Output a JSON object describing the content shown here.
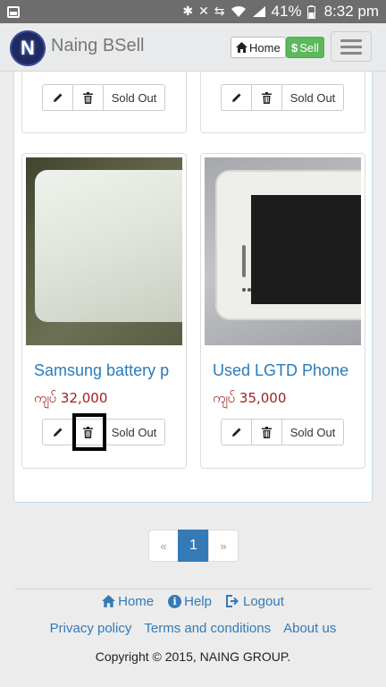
{
  "status_bar": {
    "battery": "41%",
    "time": "8:32 pm",
    "icons": [
      "screenshot-icon",
      "bluetooth-icon",
      "mute-icon",
      "data-sync-icon",
      "wifi-icon",
      "signal-icon"
    ]
  },
  "navbar": {
    "logo_letter": "N",
    "brand": "Naing BSell",
    "home_label": "Home",
    "sell_label": "Sell",
    "colors": {
      "sell": "#5cb85c",
      "logo": "#1f2a60"
    }
  },
  "products": [
    {
      "title": "",
      "price": "",
      "sold_label": "Sold Out"
    },
    {
      "title": "",
      "price": "",
      "sold_label": "Sold Out"
    },
    {
      "title": "Samsung battery p",
      "price": "ကျပ် 32,000",
      "sold_label": "Sold Out",
      "image": "white power bank"
    },
    {
      "title": "Used LGTD Phone",
      "price": "ကျပ် 35,000",
      "sold_label": "Sold Out",
      "image": "white smartphone"
    }
  ],
  "pagination": {
    "prev": "«",
    "current": "1",
    "next": "»"
  },
  "footer": {
    "home": "Home",
    "help": "Help",
    "logout": "Logout",
    "privacy": "Privacy policy",
    "terms": "Terms and conditions",
    "about": "About us",
    "copyright": "Copyright © 2015, NAING GROUP."
  },
  "colors": {
    "link": "#337ab7",
    "price": "#a02020",
    "title": "#2a7ab7"
  }
}
